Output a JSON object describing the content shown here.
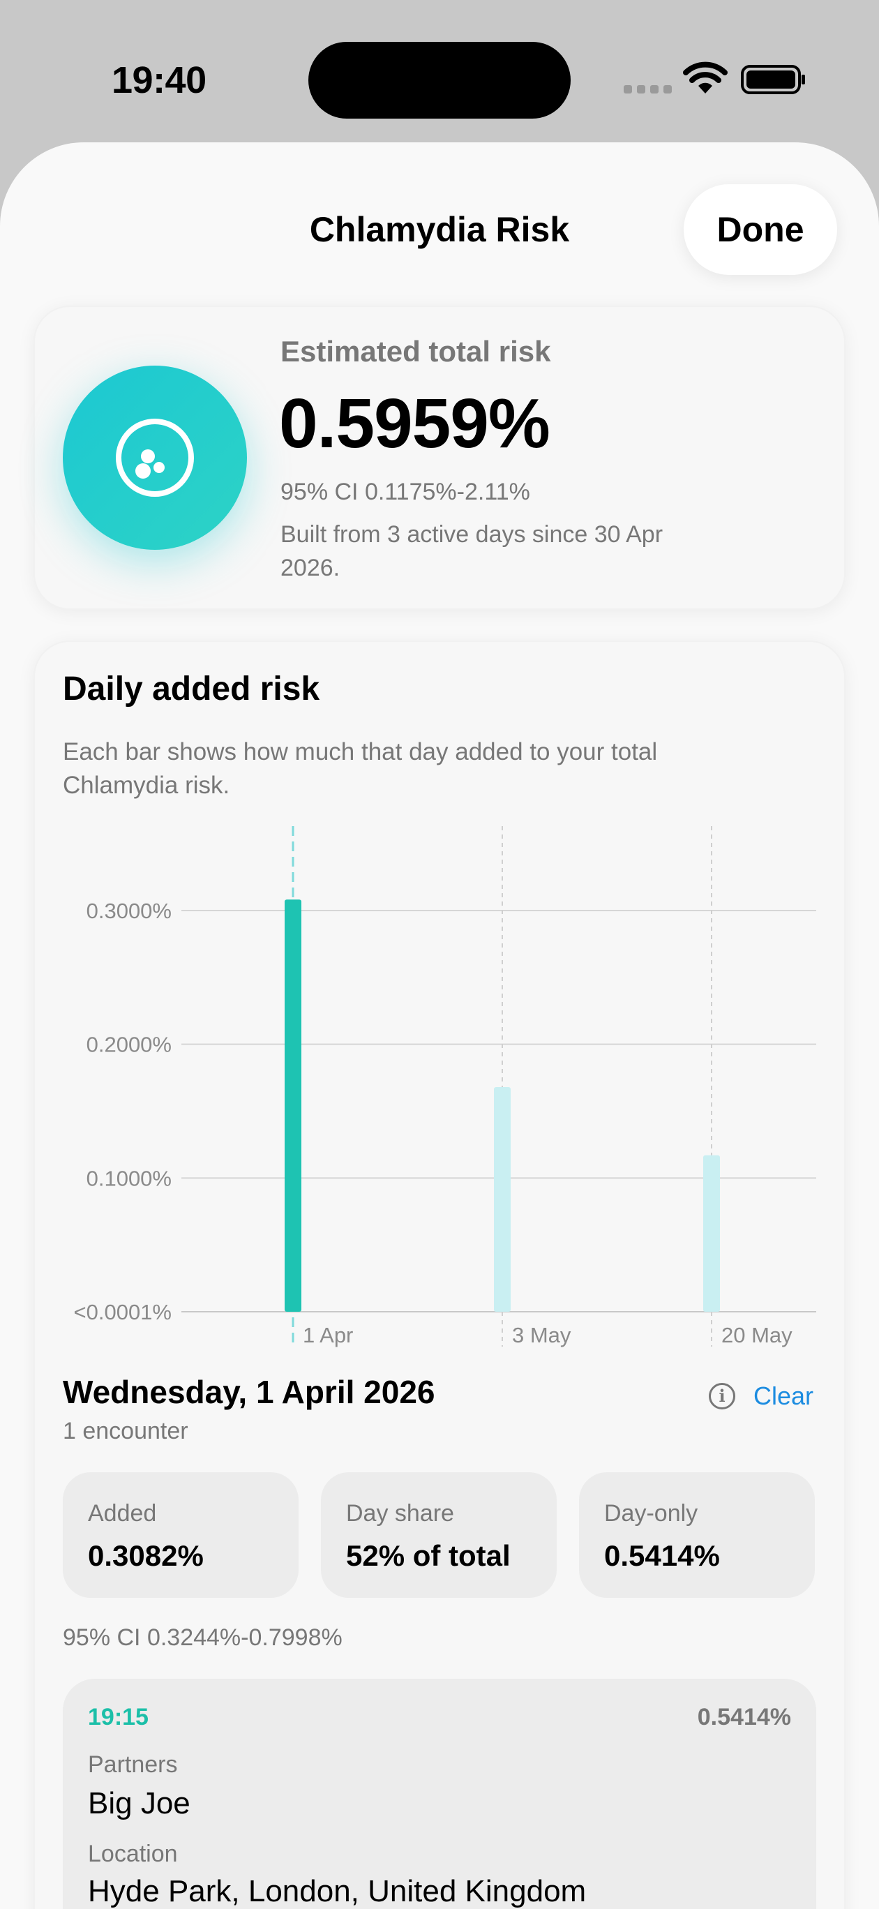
{
  "status_bar": {
    "time": "19:40"
  },
  "header": {
    "title": "Chlamydia Risk",
    "done_label": "Done"
  },
  "summary": {
    "label": "Estimated total risk",
    "value": "0.5959%",
    "ci": "95% CI 0.1175%-2.11%",
    "built": "Built from 3 active days since 30 Apr 2026."
  },
  "daily": {
    "title": "Daily added risk",
    "subtitle": "Each bar shows how much that day added to your total Chlamydia risk."
  },
  "chart_data": {
    "type": "bar",
    "categories": [
      "1 Apr",
      "3 May",
      "20 May"
    ],
    "values": [
      0.3082,
      0.168,
      0.117
    ],
    "selected_index": 0,
    "ylim": [
      0,
      0.3
    ],
    "y_ticks": [
      {
        "value": 0,
        "label": "<0.0001%"
      },
      {
        "value": 0.1,
        "label": "0.1000%"
      },
      {
        "value": 0.2,
        "label": "0.2000%"
      },
      {
        "value": 0.3,
        "label": "0.3000%"
      }
    ],
    "grid": true,
    "colors": {
      "selected": "#1ec3b2",
      "unselected": "#c9eff2",
      "grid": "#d6d6d6"
    }
  },
  "selected_day": {
    "title": "Wednesday, 1 April 2026",
    "encounters": "1 encounter",
    "clear_label": "Clear",
    "stats": [
      {
        "label": "Added",
        "value": "0.3082%"
      },
      {
        "label": "Day share",
        "value": "52% of total"
      },
      {
        "label": "Day-only",
        "value": "0.5414%"
      }
    ],
    "ci": "95% CI 0.3244%-0.7998%",
    "encounter": {
      "time": "19:15",
      "risk": "0.5414%",
      "partners_label": "Partners",
      "partners": "Big Joe",
      "location_label": "Location",
      "location": "Hyde Park, London, United Kingdom"
    }
  },
  "colors": {
    "accent": "#1ec3b2",
    "link": "#1c8ce0"
  }
}
